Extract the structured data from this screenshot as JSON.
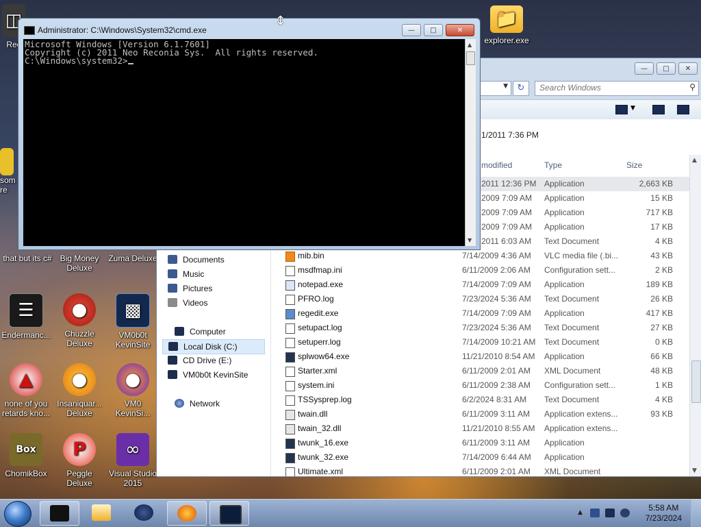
{
  "desktop_icons": [
    {
      "label": "Rec",
      "name": "recycle-bin"
    },
    {
      "label": "explorer.exe",
      "name": "explorer-exe"
    },
    {
      "label": "that but its c#",
      "name": "that-but-its-csharp"
    },
    {
      "label": "Big Money Deluxe",
      "name": "big-money-deluxe"
    },
    {
      "label": "Zuma Deluxe",
      "name": "zuma-deluxe"
    },
    {
      "label": "Endermanc...",
      "name": "endermanch"
    },
    {
      "label": "Chuzzle Deluxe",
      "name": "chuzzle-deluxe"
    },
    {
      "label": "VM0b0t KevinSite",
      "name": "vm0b0t-kevinsite"
    },
    {
      "label": "none of you retards kno...",
      "name": "none-of-you"
    },
    {
      "label": "Insaniquar... Deluxe",
      "name": "insaniquarium-deluxe"
    },
    {
      "label": "VM0 KevinSi...",
      "name": "vm0-kevinsite"
    },
    {
      "label": "ChomikBox",
      "name": "chomikbox"
    },
    {
      "label": "Peggle Deluxe",
      "name": "peggle-deluxe"
    },
    {
      "label": "Visual Studio 2015",
      "name": "visual-studio-2015"
    },
    {
      "label": "som re",
      "name": "partial-icon"
    }
  ],
  "cmd": {
    "title": "Administrator: C:\\Windows\\System32\\cmd.exe",
    "lines": [
      "Microsoft Windows [Version 6.1.7601]",
      "Copyright (c) 2011 Neo Reconia Sys.  All rights reserved.",
      "",
      "C:\\Windows\\system32>"
    ]
  },
  "explorer": {
    "search_placeholder": "Search Windows",
    "details_date": "1/2011 7:36 PM",
    "columns": {
      "modified": "modified",
      "type": "Type",
      "size": "Size"
    },
    "nav": {
      "documents": "Documents",
      "music": "Music",
      "pictures": "Pictures",
      "videos": "Videos",
      "computer": "Computer",
      "local_disk": "Local Disk (C:)",
      "cd_drive": "CD Drive (E:)",
      "vm": "VM0b0t KevinSite",
      "network": "Network"
    },
    "files": [
      {
        "name": "",
        "date": "2011 12:36 PM",
        "type": "Application",
        "size": "2,663 KB"
      },
      {
        "name": "",
        "date": "2009 7:09 AM",
        "type": "Application",
        "size": "15 KB"
      },
      {
        "name": "",
        "date": "2009 7:09 AM",
        "type": "Application",
        "size": "717 KB"
      },
      {
        "name": "",
        "date": "2009 7:09 AM",
        "type": "Application",
        "size": "17 KB"
      },
      {
        "name": "",
        "date": "2011 6:03 AM",
        "type": "Text Document",
        "size": "4 KB"
      },
      {
        "name": "mib.bin",
        "date": "7/14/2009 4:36 AM",
        "type": "VLC media file (.bi...",
        "size": "43 KB"
      },
      {
        "name": "msdfmap.ini",
        "date": "6/11/2009 2:06 AM",
        "type": "Configuration sett...",
        "size": "2 KB"
      },
      {
        "name": "notepad.exe",
        "date": "7/14/2009 7:09 AM",
        "type": "Application",
        "size": "189 KB"
      },
      {
        "name": "PFRO.log",
        "date": "7/23/2024 5:36 AM",
        "type": "Text Document",
        "size": "26 KB"
      },
      {
        "name": "regedit.exe",
        "date": "7/14/2009 7:09 AM",
        "type": "Application",
        "size": "417 KB"
      },
      {
        "name": "setupact.log",
        "date": "7/23/2024 5:36 AM",
        "type": "Text Document",
        "size": "27 KB"
      },
      {
        "name": "setuperr.log",
        "date": "7/14/2009 10:21 AM",
        "type": "Text Document",
        "size": "0 KB"
      },
      {
        "name": "splwow64.exe",
        "date": "11/21/2010 8:54 AM",
        "type": "Application",
        "size": "66 KB"
      },
      {
        "name": "Starter.xml",
        "date": "6/11/2009 2:01 AM",
        "type": "XML Document",
        "size": "48 KB"
      },
      {
        "name": "system.ini",
        "date": "6/11/2009 2:38 AM",
        "type": "Configuration sett...",
        "size": "1 KB"
      },
      {
        "name": "TSSysprep.log",
        "date": "6/2/2024 8:31 AM",
        "type": "Text Document",
        "size": "4 KB"
      },
      {
        "name": "twain.dll",
        "date": "6/11/2009 3:11 AM",
        "type": "Application extens...",
        "size": "93 KB"
      },
      {
        "name": "twain_32.dll",
        "date": "11/21/2010 8:55 AM",
        "type": "Application extens...",
        "size": ""
      },
      {
        "name": "twunk_16.exe",
        "date": "6/11/2009 3:11 AM",
        "type": "Application",
        "size": ""
      },
      {
        "name": "twunk_32.exe",
        "date": "7/14/2009 6:44 AM",
        "type": "Application",
        "size": ""
      },
      {
        "name": "Ultimate.xml",
        "date": "6/11/2009 2:01 AM",
        "type": "XML Document",
        "size": ""
      }
    ]
  },
  "taskbar": {
    "time": "5:58 AM",
    "date": "7/23/2024",
    "tray_chevron": "▲"
  },
  "colors": {
    "cmd_bg": "#000000",
    "cmd_text": "#c0c0c0",
    "taskbar": "#7f98be",
    "selected_nav": "#dcebfa"
  }
}
